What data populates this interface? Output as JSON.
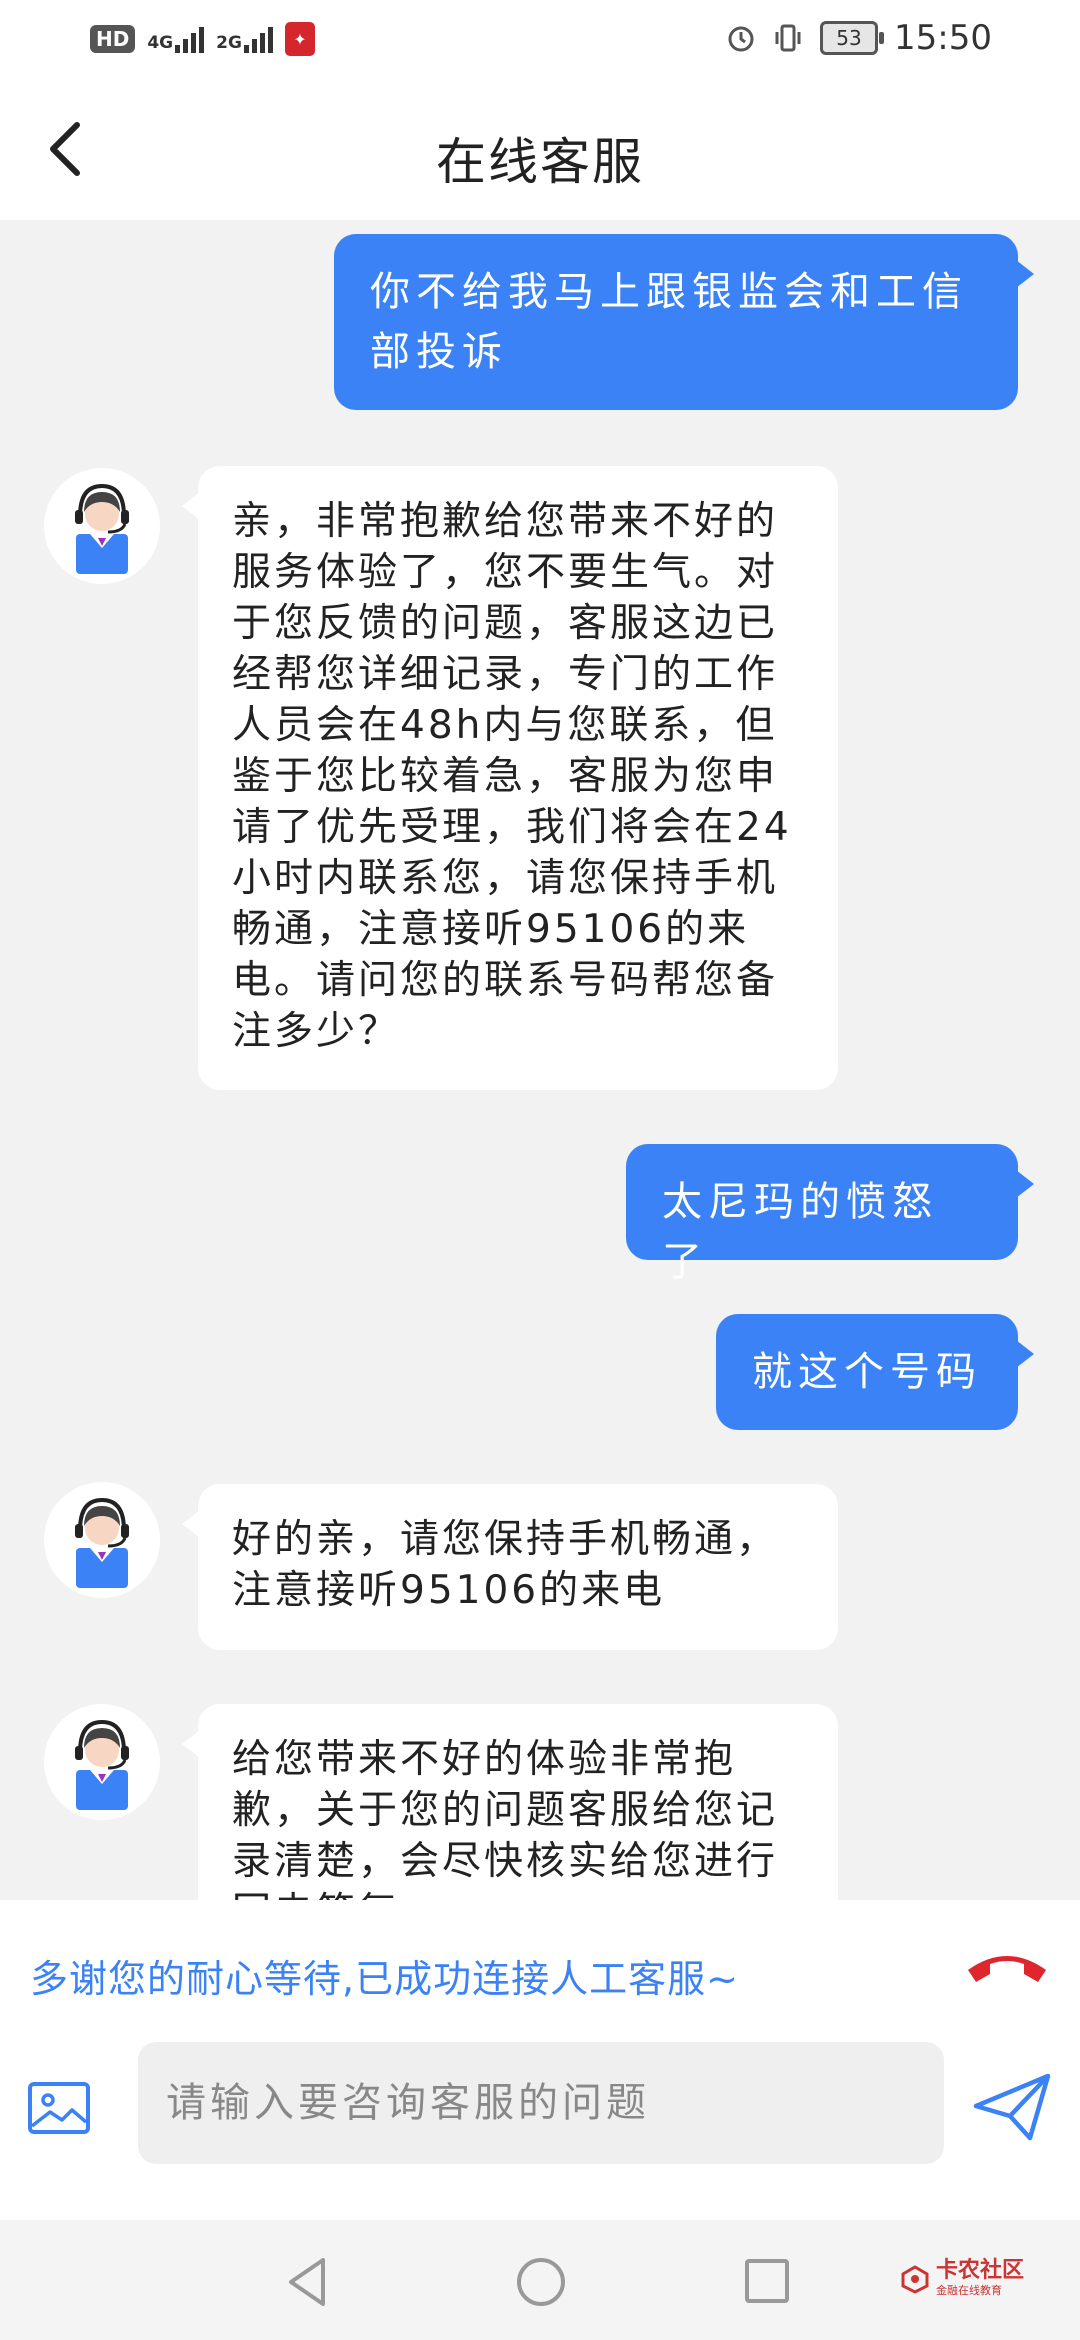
{
  "status_bar": {
    "hd": "HD",
    "net1": "4G",
    "net2": "2G",
    "battery": "53",
    "time": "15:50"
  },
  "header": {
    "title": "在线客服"
  },
  "messages": [
    {
      "side": "right",
      "text": "你不给我马上跟银监会和工信部投诉"
    },
    {
      "side": "left",
      "text": "亲，非常抱歉给您带来不好的服务体验了，您不要生气。对于您反馈的问题，客服这边已经帮您详细记录，专门的工作人员会在48h内与您联系，但鉴于您比较着急，客服为您申请了优先受理，我们将会在24小时内联系您，请您保持手机畅通，注意接听95106的来电。请问您的联系号码帮您备注多少？"
    },
    {
      "side": "right",
      "text": "太尼玛的愤怒了"
    },
    {
      "side": "right",
      "text": "就这个号码"
    },
    {
      "side": "left",
      "text": "好的亲，请您保持手机畅通，注意接听95106的来电"
    },
    {
      "side": "left",
      "text": "给您带来不好的体验非常抱歉，关于您的问题客服给您记录清楚，会尽快核实给您进行回电答复"
    }
  ],
  "connection": {
    "text": "多谢您的耐心等待,已成功连接人工客服~"
  },
  "input": {
    "placeholder": "请输入要咨询客服的问题",
    "value": ""
  },
  "watermark": {
    "text": "卡农社区",
    "sub": "金融在线教育"
  },
  "colors": {
    "accent": "#3b82f6",
    "hangup": "#e0262d",
    "background": "#f2f2f2"
  }
}
